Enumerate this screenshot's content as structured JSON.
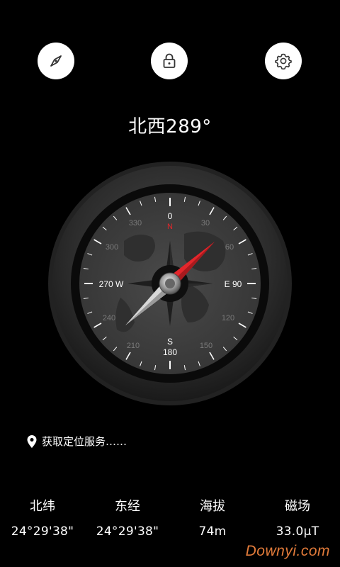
{
  "toolbar": {
    "compass_icon": "compass-icon",
    "lock_icon": "lock-icon",
    "settings_icon": "gear-icon"
  },
  "heading": "北西289°",
  "compass": {
    "bearing": 289,
    "dial": {
      "n_num": "0",
      "n_letter": "N",
      "e_label": "E 90",
      "w_label": "270 W",
      "s_letter": "S",
      "s_num": "180",
      "d330": "330",
      "d30": "30",
      "d300": "300",
      "d60": "60",
      "d240": "240",
      "d120": "120",
      "d210": "210",
      "d150": "150"
    },
    "colors": {
      "north_marker": "#e3262b",
      "needle_north": "#e3262b",
      "needle_south": "#d8d8d8"
    }
  },
  "location": {
    "icon": "map-pin-icon",
    "text": "获取定位服务……"
  },
  "stats": [
    {
      "label": "北纬",
      "value": "24°29'38\""
    },
    {
      "label": "东经",
      "value": "24°29'38\""
    },
    {
      "label": "海拔",
      "value": "74m"
    },
    {
      "label": "磁场",
      "value": "33.0μT"
    }
  ],
  "watermark": "Downyi.com"
}
